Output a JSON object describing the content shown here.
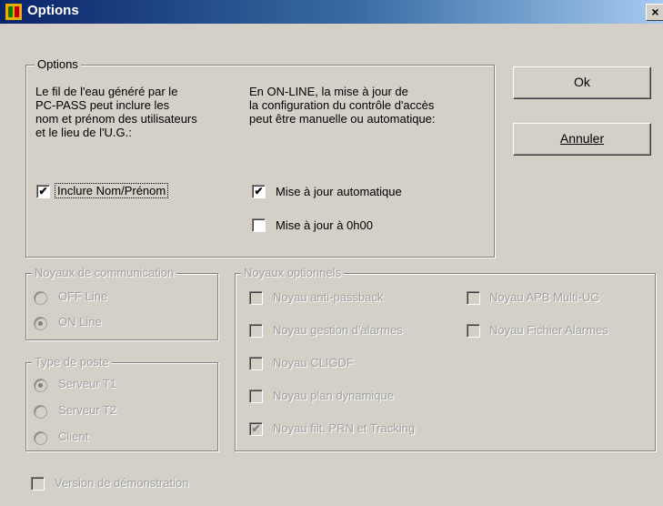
{
  "window": {
    "title": "Options",
    "close_glyph": "×"
  },
  "options_group": {
    "legend": "Options",
    "left_text": [
      "Le fil de l'eau généré par le",
      "PC-PASS peut inclure les",
      "nom et prénom des utilisateurs",
      "et le lieu de l'U.G.:"
    ],
    "right_text": [
      "En ON-LINE, la mise à jour de",
      "la configuration du contrôle d'accès",
      "peut être manuelle ou automatique:"
    ],
    "include_name": {
      "label": "Inclure Nom/Prénom",
      "checked": true
    },
    "auto_update": {
      "label": "Mise à jour automatique",
      "checked": true
    },
    "update_midnight": {
      "label": "Mise à jour à 0h00",
      "checked": false
    }
  },
  "buttons": {
    "ok": "Ok",
    "cancel": "Annuler"
  },
  "comm_group": {
    "legend": "Noyaux de communication",
    "options": [
      {
        "label": "OFF Line",
        "selected": false
      },
      {
        "label": "ON Line",
        "selected": true
      }
    ]
  },
  "post_group": {
    "legend": "Type de poste",
    "options": [
      {
        "label": "Serveur T1",
        "selected": true
      },
      {
        "label": "Serveur T2",
        "selected": false
      },
      {
        "label": "Client",
        "selected": false
      }
    ]
  },
  "optional_group": {
    "legend": "Noyaux optionnels",
    "left": [
      {
        "label": "Noyau anti-passback",
        "checked": false
      },
      {
        "label": "Noyau gestion d'alarmes",
        "checked": false
      },
      {
        "label": "Noyau CLIGDF",
        "checked": false
      },
      {
        "label": "Noyau plan dynamique",
        "checked": false
      },
      {
        "label": "Noyau filt. PRN et Tracking",
        "checked": true
      }
    ],
    "right": [
      {
        "label": "Noyau APB Multi-UG",
        "checked": false
      },
      {
        "label": "Noyau Fichier Alarmes",
        "checked": false
      }
    ]
  },
  "demo": {
    "label": "Version de démonstration",
    "checked": false
  },
  "colors": {
    "title_start": "#0a246a",
    "title_end": "#a6caf0",
    "face": "#d4d0c8"
  }
}
